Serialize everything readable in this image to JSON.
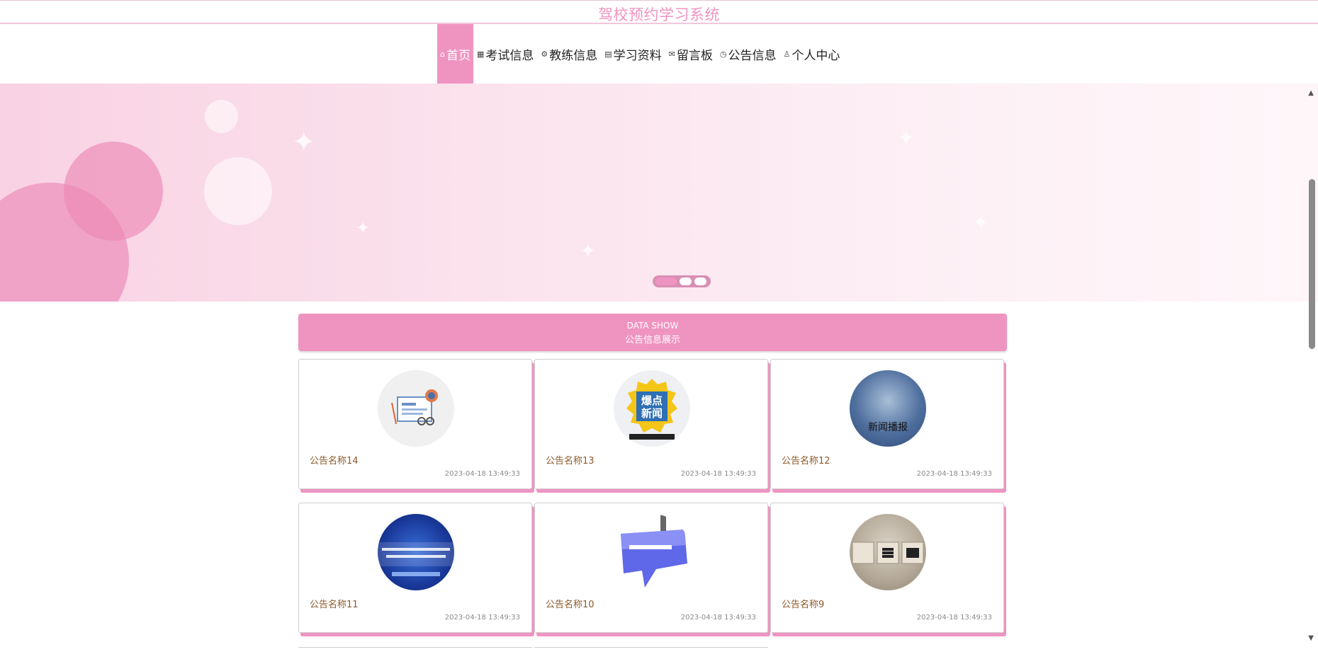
{
  "header": {
    "title": "驾校预约学习系统"
  },
  "nav": {
    "items": [
      {
        "label": "首页",
        "icon": "home-icon",
        "active": true
      },
      {
        "label": "考试信息",
        "icon": "grid-icon",
        "active": false
      },
      {
        "label": "教练信息",
        "icon": "gear-icon",
        "active": false
      },
      {
        "label": "学习资料",
        "icon": "book-icon",
        "active": false
      },
      {
        "label": "留言板",
        "icon": "mail-icon",
        "active": false
      },
      {
        "label": "公告信息",
        "icon": "clock-icon",
        "active": false
      },
      {
        "label": "个人中心",
        "icon": "user-icon",
        "active": false
      }
    ]
  },
  "section": {
    "title_en": "DATA SHOW",
    "title_cn": "公告信息展示"
  },
  "notices": [
    {
      "title": "公告名称14",
      "date": "2023-04-18 13:49:33",
      "image_text": ""
    },
    {
      "title": "公告名称13",
      "date": "2023-04-18 13:49:33",
      "image_text": ""
    },
    {
      "title": "公告名称12",
      "date": "2023-04-18 13:49:33",
      "image_text": "新闻播报"
    },
    {
      "title": "公告名称11",
      "date": "2023-04-18 13:49:33",
      "image_text": ""
    },
    {
      "title": "公告名称10",
      "date": "2023-04-18 13:49:33",
      "image_text": ""
    },
    {
      "title": "公告名称9",
      "date": "2023-04-18 13:49:33",
      "image_text": ""
    }
  ],
  "colors": {
    "accent": "#ef94c1",
    "title_text": "#8b5a2b",
    "date_text": "#8a8a8a"
  }
}
